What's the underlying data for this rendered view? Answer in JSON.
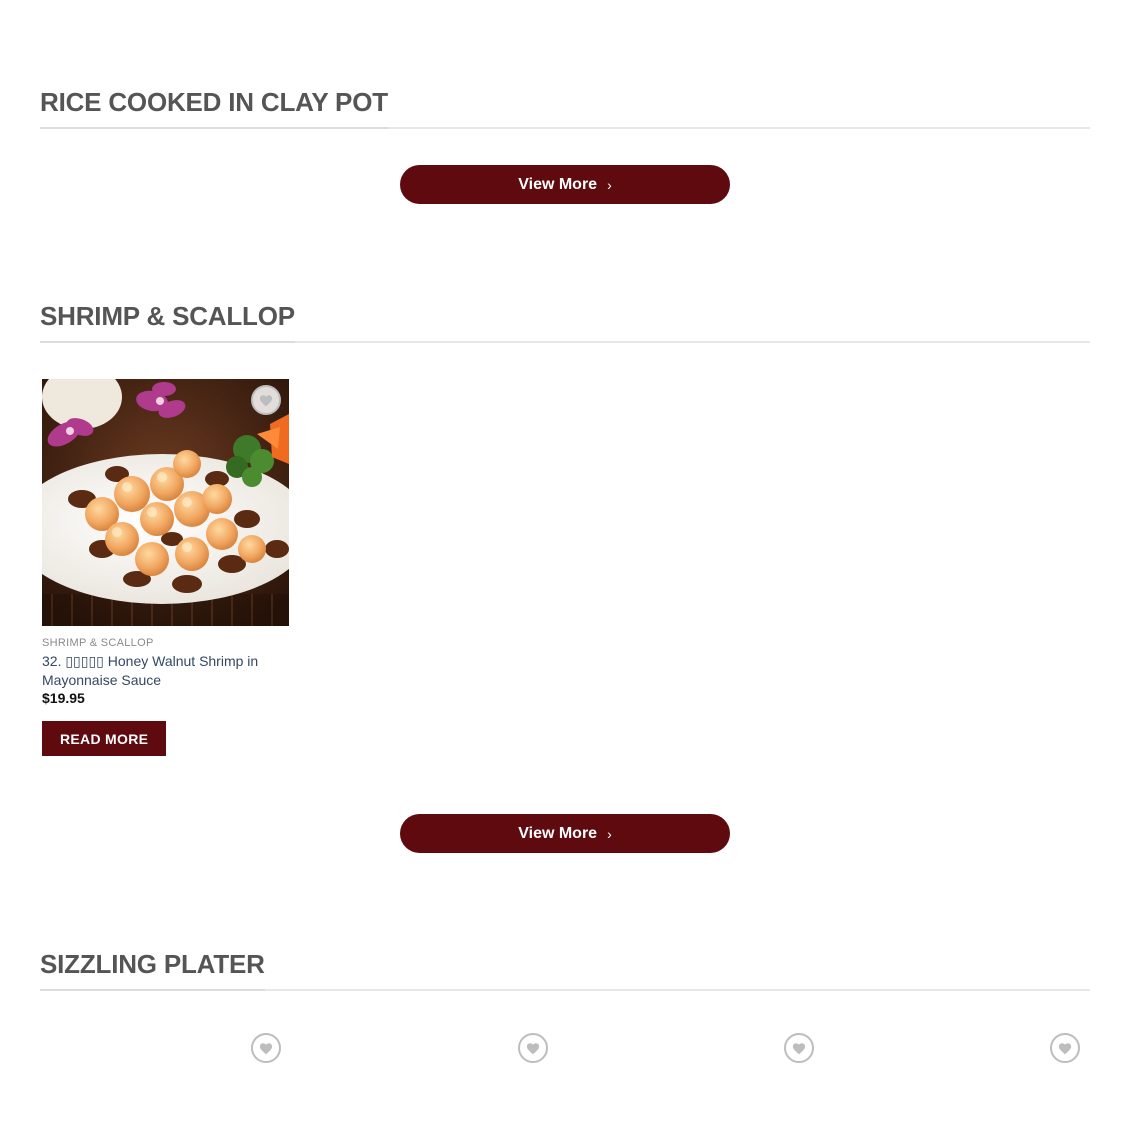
{
  "sections": [
    {
      "title": "RICE COOKED IN CLAY POT",
      "view_more_label": "View More"
    },
    {
      "title": "SHRIMP & SCALLOP",
      "view_more_label": "View More",
      "products": [
        {
          "category": "SHRIMP & SCALLOP",
          "title": "32. ▯▯▯▯▯ Honey Walnut Shrimp in Mayonnaise Sauce",
          "price": "$19.95",
          "button_label": "READ MORE",
          "image_icon": "honey-walnut-shrimp-photo"
        }
      ]
    },
    {
      "title": "SIZZLING PLATER"
    }
  ],
  "icons": {
    "wishlist": "heart-icon",
    "view_more_chevron": "chevron-right-icon"
  },
  "colors": {
    "brand": "#5f0a0f",
    "heading": "#555555",
    "link": "#334862"
  }
}
